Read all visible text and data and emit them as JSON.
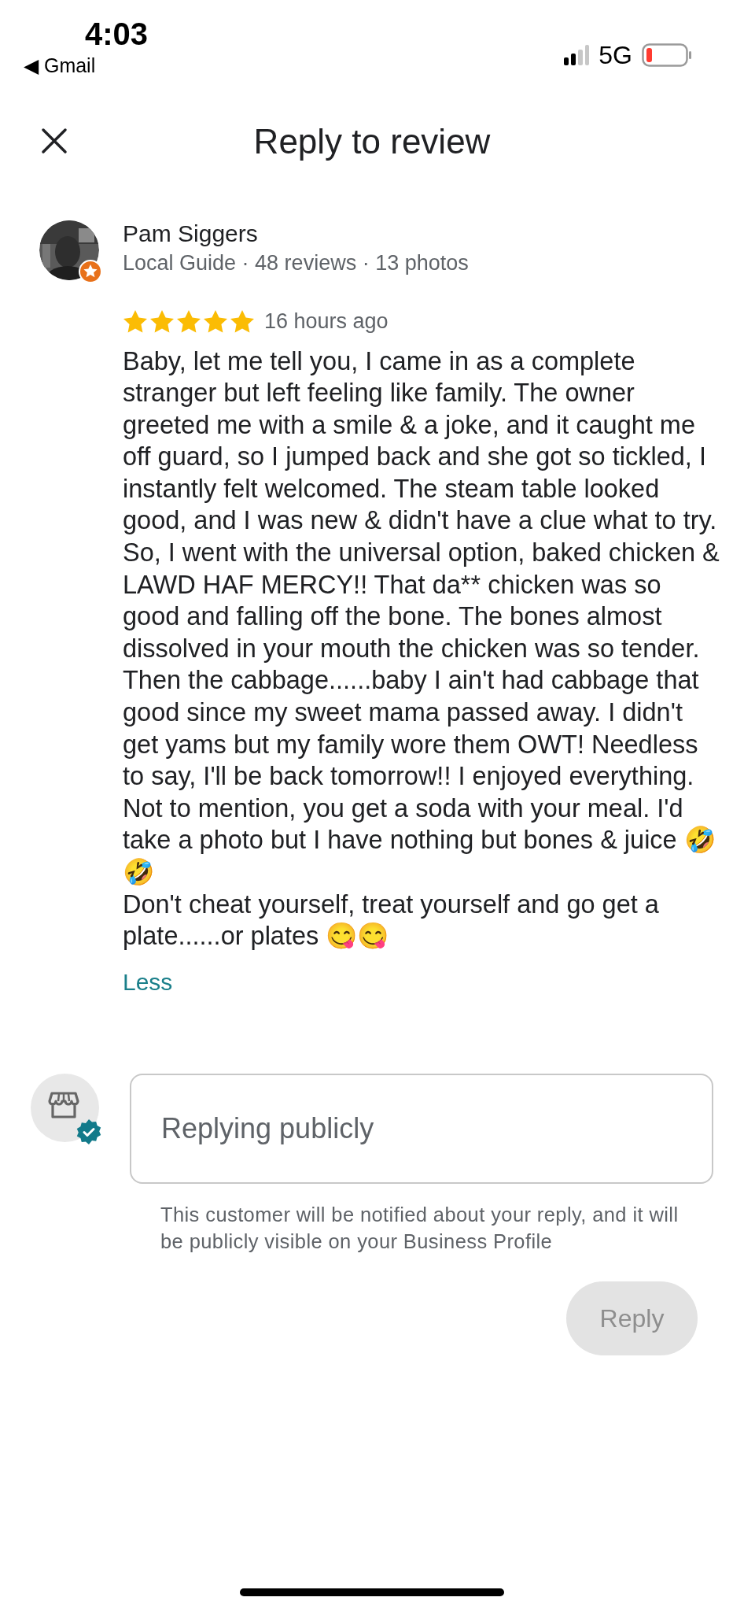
{
  "status_bar": {
    "time": "4:03",
    "back_app": "◀ Gmail",
    "network": "5G"
  },
  "header": {
    "title": "Reply to review"
  },
  "review": {
    "author": "Pam Siggers",
    "meta": "Local Guide · 48 reviews · 13 photos",
    "stars": 5,
    "time": "16 hours ago",
    "paragraphs": [
      "Baby, let me tell you, I came in as a complete stranger but left feeling like family. The owner greeted me with a smile & a joke, and it caught me off guard, so I jumped back and she got so tickled, I instantly felt welcomed. The steam table looked good, and I was new & didn't have a clue what to try. So, I went with the universal option, baked chicken & LAWD HAF MERCY!! That da** chicken was so good and falling off the bone. The bones almost dissolved in your mouth the chicken was so tender. Then the cabbage......baby I ain't had cabbage that good since my sweet mama passed away. I didn't get yams but my family wore them OWT! Needless to say, I'll be back tomorrow!! I enjoyed everything. Not to mention, you get a soda with your meal. I'd take a photo but I have nothing but bones & juice 🤣🤣",
      "Don't cheat yourself, treat yourself and go get a plate......or plates 😋😋"
    ],
    "toggle": "Less"
  },
  "reply": {
    "placeholder": "Replying publicly",
    "note": "This customer will be notified about your reply, and it will be publicly visible on your Business Profile",
    "button": "Reply",
    "disabled": true
  }
}
